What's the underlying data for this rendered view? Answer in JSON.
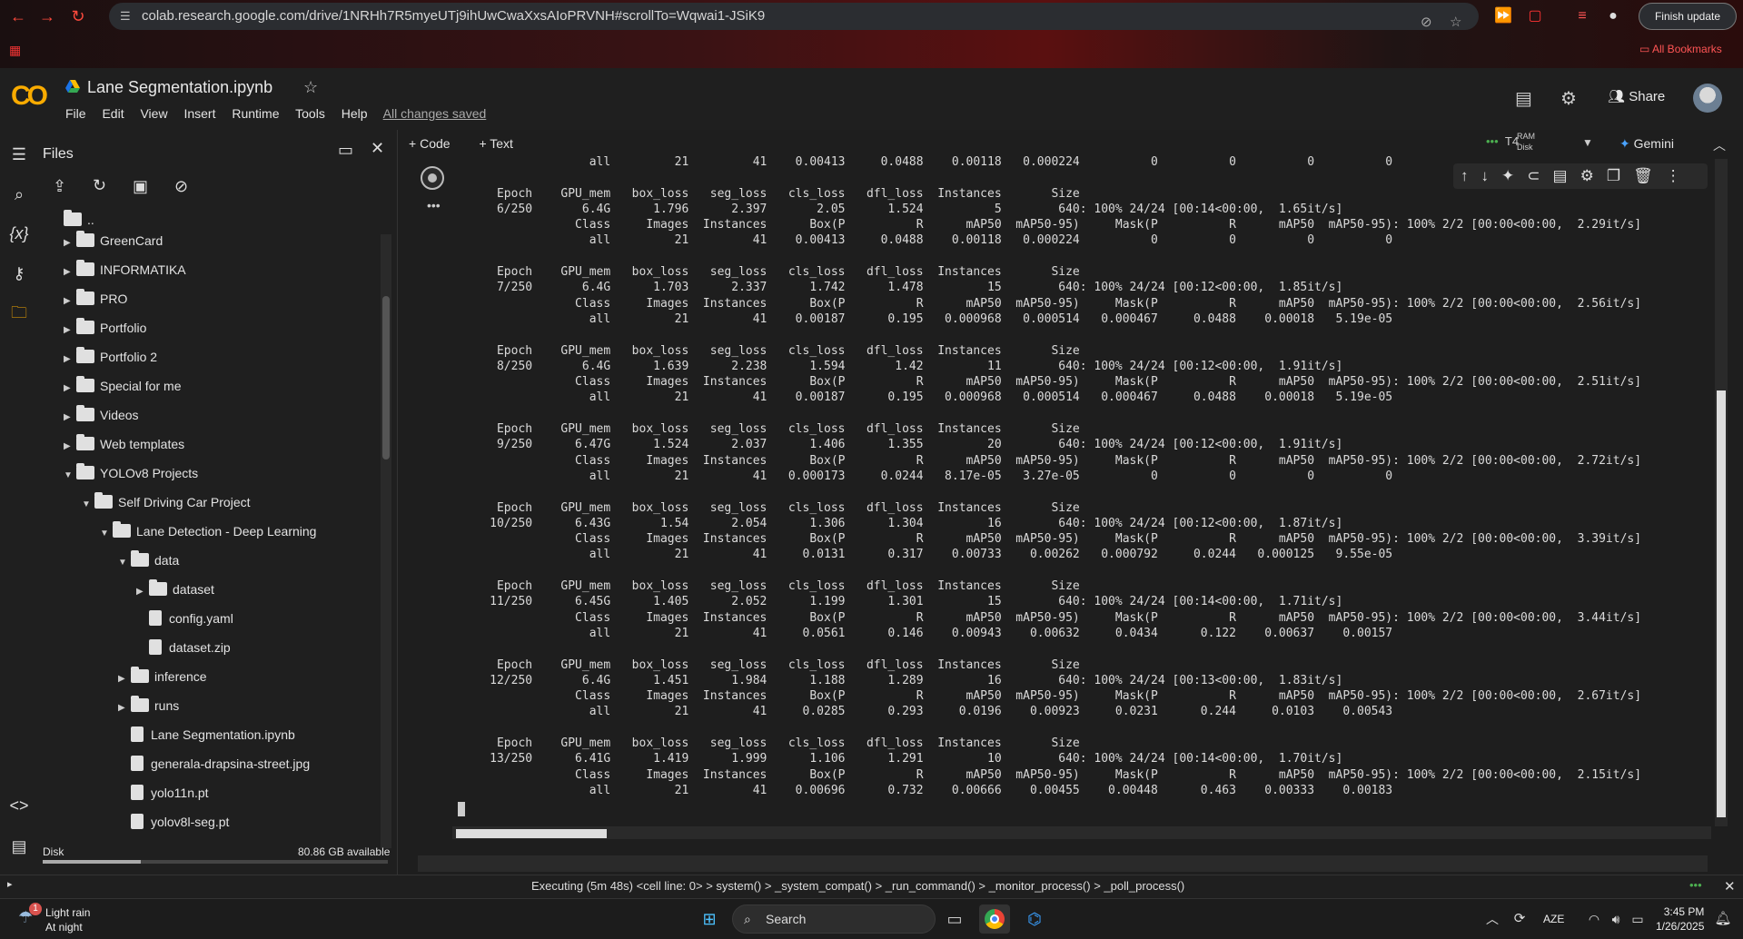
{
  "browser": {
    "url": "colab.research.google.com/drive/1NRHh7R5myeUTj9ihUwCwaXxsAIoPRVNH#scrollTo=Wqwai1-JSiK9",
    "finish_update": "Finish update",
    "all_bookmarks": "All Bookmarks"
  },
  "header": {
    "logo": "CO",
    "title": "Lane Segmentation.ipynb",
    "menu": [
      "File",
      "Edit",
      "View",
      "Insert",
      "Runtime",
      "Tools",
      "Help"
    ],
    "saved": "All changes saved",
    "share": "Share"
  },
  "files": {
    "title": "Files",
    "parent": "..",
    "tree": [
      {
        "label": "GreenCard",
        "type": "folder",
        "depth": 1,
        "expanded": false
      },
      {
        "label": "INFORMATIKA",
        "type": "folder",
        "depth": 1,
        "expanded": false
      },
      {
        "label": "PRO",
        "type": "folder",
        "depth": 1,
        "expanded": false
      },
      {
        "label": "Portfolio",
        "type": "folder",
        "depth": 1,
        "expanded": false
      },
      {
        "label": "Portfolio 2",
        "type": "folder",
        "depth": 1,
        "expanded": false
      },
      {
        "label": "Special for me",
        "type": "folder",
        "depth": 1,
        "expanded": false
      },
      {
        "label": "Videos",
        "type": "folder",
        "depth": 1,
        "expanded": false
      },
      {
        "label": "Web templates",
        "type": "folder",
        "depth": 1,
        "expanded": false
      },
      {
        "label": "YOLOv8 Projects",
        "type": "folder",
        "depth": 1,
        "expanded": true
      },
      {
        "label": "Self Driving Car Project",
        "type": "folder",
        "depth": 2,
        "expanded": true
      },
      {
        "label": "Lane Detection - Deep Learning",
        "type": "folder",
        "depth": 3,
        "expanded": true
      },
      {
        "label": "data",
        "type": "folder",
        "depth": 4,
        "expanded": true
      },
      {
        "label": "dataset",
        "type": "folder",
        "depth": 5,
        "expanded": false
      },
      {
        "label": "config.yaml",
        "type": "file",
        "depth": 5
      },
      {
        "label": "dataset.zip",
        "type": "file",
        "depth": 5
      },
      {
        "label": "inference",
        "type": "folder",
        "depth": 4,
        "expanded": false
      },
      {
        "label": "runs",
        "type": "folder",
        "depth": 4,
        "expanded": false
      },
      {
        "label": "Lane Segmentation.ipynb",
        "type": "file",
        "depth": 4
      },
      {
        "label": "generala-drapsina-street.jpg",
        "type": "file",
        "depth": 4
      },
      {
        "label": "yolo11n.pt",
        "type": "file",
        "depth": 4
      },
      {
        "label": "yolov8l-seg.pt",
        "type": "file",
        "depth": 4
      }
    ],
    "disk_label": "Disk",
    "disk_available": "80.86 GB available"
  },
  "toolbar": {
    "code": "Code",
    "text": "Text",
    "runtime": "T4",
    "ram": "RAM",
    "disk": "Disk",
    "gemini": "Gemini"
  },
  "output": {
    "lines": [
      "                   all         21         41    0.00413     0.0488    0.00118   0.000224          0          0          0          0",
      "",
      "      Epoch    GPU_mem   box_loss   seg_loss   cls_loss   dfl_loss  Instances       Size",
      "      6/250       6.4G      1.796      2.397       2.05      1.524          5        640: 100% 24/24 [00:14<00:00,  1.65it/s]",
      "                 Class     Images  Instances      Box(P          R      mAP50  mAP50-95)     Mask(P          R      mAP50  mAP50-95): 100% 2/2 [00:00<00:00,  2.29it/s]",
      "                   all         21         41    0.00413     0.0488    0.00118   0.000224          0          0          0          0",
      "",
      "      Epoch    GPU_mem   box_loss   seg_loss   cls_loss   dfl_loss  Instances       Size",
      "      7/250       6.4G      1.703      2.337      1.742      1.478         15        640: 100% 24/24 [00:12<00:00,  1.85it/s]",
      "                 Class     Images  Instances      Box(P          R      mAP50  mAP50-95)     Mask(P          R      mAP50  mAP50-95): 100% 2/2 [00:00<00:00,  2.56it/s]",
      "                   all         21         41    0.00187      0.195   0.000968   0.000514   0.000467     0.0488    0.00018   5.19e-05",
      "",
      "      Epoch    GPU_mem   box_loss   seg_loss   cls_loss   dfl_loss  Instances       Size",
      "      8/250       6.4G      1.639      2.238      1.594       1.42         11        640: 100% 24/24 [00:12<00:00,  1.91it/s]",
      "                 Class     Images  Instances      Box(P          R      mAP50  mAP50-95)     Mask(P          R      mAP50  mAP50-95): 100% 2/2 [00:00<00:00,  2.51it/s]",
      "                   all         21         41    0.00187      0.195   0.000968   0.000514   0.000467     0.0488    0.00018   5.19e-05",
      "",
      "      Epoch    GPU_mem   box_loss   seg_loss   cls_loss   dfl_loss  Instances       Size",
      "      9/250      6.47G      1.524      2.037      1.406      1.355         20        640: 100% 24/24 [00:12<00:00,  1.91it/s]",
      "                 Class     Images  Instances      Box(P          R      mAP50  mAP50-95)     Mask(P          R      mAP50  mAP50-95): 100% 2/2 [00:00<00:00,  2.72it/s]",
      "                   all         21         41   0.000173     0.0244   8.17e-05   3.27e-05          0          0          0          0",
      "",
      "      Epoch    GPU_mem   box_loss   seg_loss   cls_loss   dfl_loss  Instances       Size",
      "     10/250      6.43G       1.54      2.054      1.306      1.304         16        640: 100% 24/24 [00:12<00:00,  1.87it/s]",
      "                 Class     Images  Instances      Box(P          R      mAP50  mAP50-95)     Mask(P          R      mAP50  mAP50-95): 100% 2/2 [00:00<00:00,  3.39it/s]",
      "                   all         21         41     0.0131      0.317    0.00733    0.00262   0.000792     0.0244   0.000125   9.55e-05",
      "",
      "      Epoch    GPU_mem   box_loss   seg_loss   cls_loss   dfl_loss  Instances       Size",
      "     11/250      6.45G      1.405      2.052      1.199      1.301         15        640: 100% 24/24 [00:14<00:00,  1.71it/s]",
      "                 Class     Images  Instances      Box(P          R      mAP50  mAP50-95)     Mask(P          R      mAP50  mAP50-95): 100% 2/2 [00:00<00:00,  3.44it/s]",
      "                   all         21         41     0.0561      0.146    0.00943    0.00632     0.0434      0.122    0.00637    0.00157",
      "",
      "      Epoch    GPU_mem   box_loss   seg_loss   cls_loss   dfl_loss  Instances       Size",
      "     12/250       6.4G      1.451      1.984      1.188      1.289         16        640: 100% 24/24 [00:13<00:00,  1.83it/s]",
      "                 Class     Images  Instances      Box(P          R      mAP50  mAP50-95)     Mask(P          R      mAP50  mAP50-95): 100% 2/2 [00:00<00:00,  2.67it/s]",
      "                   all         21         41     0.0285      0.293     0.0196    0.00923     0.0231      0.244     0.0103    0.00543",
      "",
      "      Epoch    GPU_mem   box_loss   seg_loss   cls_loss   dfl_loss  Instances       Size",
      "     13/250      6.41G      1.419      1.999      1.106      1.291         10        640: 100% 24/24 [00:14<00:00,  1.70it/s]",
      "                 Class     Images  Instances      Box(P          R      mAP50  mAP50-95)     Mask(P          R      mAP50  mAP50-95): 100% 2/2 [00:00<00:00,  2.15it/s]",
      "                   all         21         41    0.00696      0.732    0.00666    0.00455    0.00448      0.463    0.00333    0.00183"
    ]
  },
  "status": {
    "text": "Executing (5m 48s) <cell line: 0> > system() > _system_compat() > _run_command() > _monitor_process() > _poll_process()"
  },
  "taskbar": {
    "weather_title": "Light rain",
    "weather_sub": "At night",
    "weather_badge": "1",
    "search": "Search",
    "lang": "AZE",
    "time": "3:45 PM",
    "date": "1/26/2025"
  },
  "colors": {
    "accent": "#f9ab00",
    "browser_red": "#ff4a3d"
  }
}
